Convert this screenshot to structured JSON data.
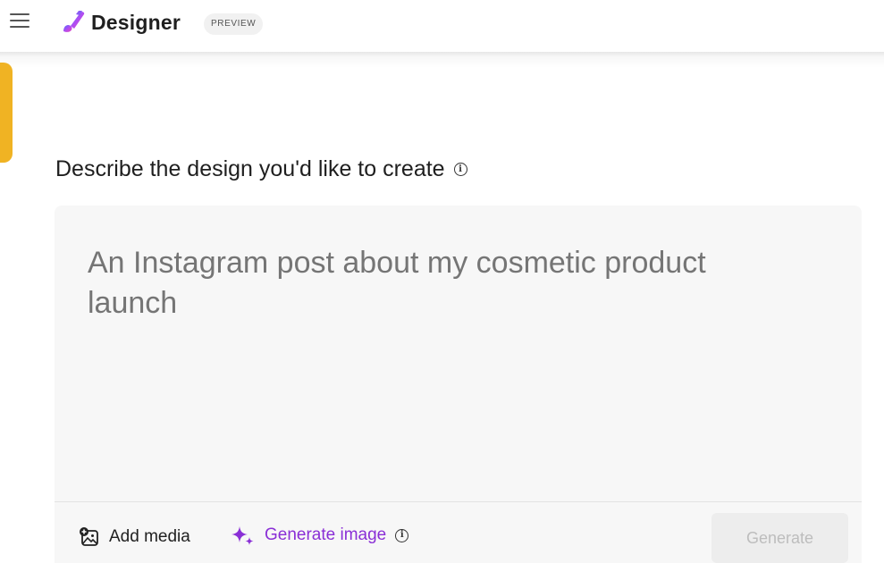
{
  "header": {
    "brand": "Designer",
    "badge": "PREVIEW",
    "menu_icon": "hamburger-menu-icon",
    "logo_icon": "designer-logo-icon"
  },
  "main": {
    "heading": "Describe the design you'd like to create",
    "heading_info_icon": "info-icon",
    "prompt_placeholder": "An Instagram post about my cosmetic product launch",
    "actions": {
      "add_media_label": "Add media",
      "add_media_icon": "image-add-icon",
      "generate_image_label": "Generate image",
      "generate_image_icon": "sparkle-icon",
      "generate_button_label": "Generate"
    }
  },
  "colors": {
    "accent_purple": "#8a2fd6",
    "yellow_tab": "#f0b323",
    "prompt_background": "#f7f7f7"
  }
}
